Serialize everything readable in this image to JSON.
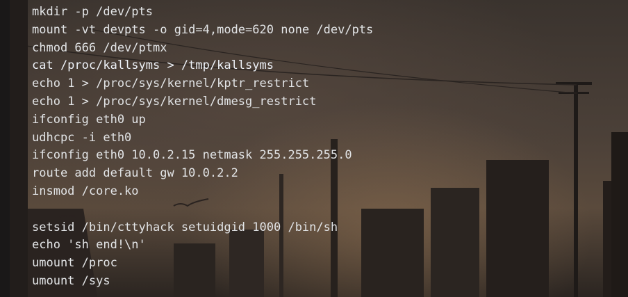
{
  "editor": {
    "lines": [
      {
        "text": "mkdir -p /dev/pts",
        "selected": false
      },
      {
        "text": "mount -vt devpts -o gid=4,mode=620 none /dev/pts",
        "selected": false
      },
      {
        "text": "chmod 666 /dev/ptmx",
        "selected": false
      },
      {
        "text": "cat /proc/kallsyms > /tmp/kallsyms",
        "selected": true
      },
      {
        "text": "echo 1 > /proc/sys/kernel/kptr_restrict",
        "selected": false
      },
      {
        "text": "echo 1 > /proc/sys/kernel/dmesg_restrict",
        "selected": false
      },
      {
        "text": "ifconfig eth0 up",
        "selected": false
      },
      {
        "text": "udhcpc -i eth0",
        "selected": false
      },
      {
        "text": "ifconfig eth0 10.0.2.15 netmask 255.255.255.0",
        "selected": false
      },
      {
        "text": "route add default gw 10.0.2.2",
        "selected": false
      },
      {
        "text": "insmod /core.ko",
        "selected": false
      },
      {
        "text": "",
        "selected": false
      },
      {
        "text": "setsid /bin/cttyhack setuidgid 1000 /bin/sh",
        "selected": false
      },
      {
        "text": "echo 'sh end!\\n'",
        "selected": false
      },
      {
        "text": "umount /proc",
        "selected": false
      },
      {
        "text": "umount /sys",
        "selected": false
      }
    ]
  },
  "colors": {
    "text": "#e2e4e6",
    "selection": "#34568c"
  }
}
